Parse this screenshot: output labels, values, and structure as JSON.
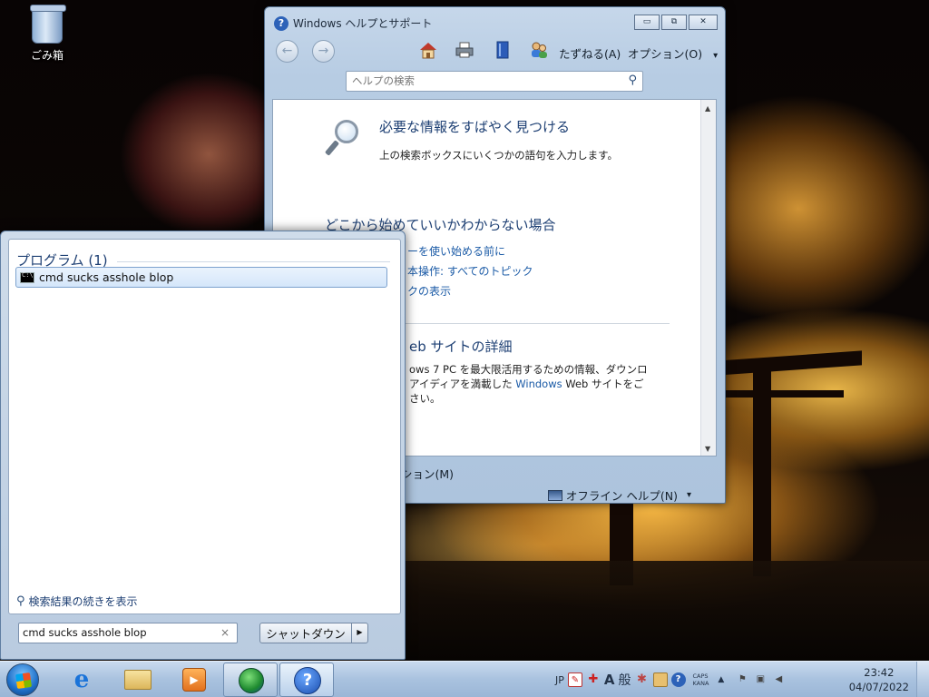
{
  "desktop": {
    "recycle_bin_label": "ごみ箱"
  },
  "help_window": {
    "title": "Windows ヘルプとサポート",
    "window_controls": {
      "minimize": "▭",
      "maximize": "⧉",
      "close": "✕"
    },
    "toolbar": {
      "home_icon": "house-icon",
      "print_icon": "printer-icon",
      "browse_icon": "book-icon",
      "ask_icon": "people-icon",
      "ask_label": "たずねる(A)",
      "options_label": "オプション(O)",
      "options_arrow": "▾"
    },
    "search": {
      "placeholder": "ヘルプの検索",
      "icon": "search-icon"
    },
    "content": {
      "heading": "必要な情報をすばやく見つける",
      "description": "上の検索ボックスにいくつかの語句を入力します。",
      "heading2": "どこから始めていいかわからない場合",
      "links": [
        "ーを使い始める前に",
        "本操作: すべてのトピック",
        "クの表示"
      ],
      "heading3": "eb サイトの詳細",
      "paragraph_lines": [
        "ows 7 PC を最大限活用するための情報、ダウンロ",
        "アイディアを満載した",
        "Windows",
        "Web サイトをご",
        "さい。"
      ]
    },
    "bottom": {
      "options_label": "ション(M)",
      "offline_label": "オフライン ヘルプ(N)",
      "offline_arrow": "▾"
    }
  },
  "start_menu": {
    "section_heading": "プログラム (1)",
    "result_label": "cmd sucks asshole blop",
    "more_results_label": "検索結果の続きを表示",
    "search_value": "cmd sucks asshole blop",
    "clear_glyph": "×",
    "shutdown_label": "シャットダウン",
    "shutdown_arrow": "▶"
  },
  "taskbar": {
    "pinned": [
      {
        "name": "internet-explorer",
        "icon": "ie-icon",
        "glyph": "e"
      },
      {
        "name": "windows-explorer",
        "icon": "folder-icon"
      },
      {
        "name": "media-player",
        "icon": "media-player-icon",
        "glyph": "▶"
      },
      {
        "name": "network-app",
        "icon": "globe-icon"
      },
      {
        "name": "help-and-support",
        "icon": "help-icon",
        "glyph": "?"
      }
    ],
    "tray": {
      "language": "JP",
      "ime_mode": "A",
      "ime_kanji": "般",
      "caps": "CAPS",
      "kana": "KANA",
      "expand_arrow": "▲"
    },
    "clock": {
      "time": "23:42",
      "date": "04/07/2022"
    }
  }
}
